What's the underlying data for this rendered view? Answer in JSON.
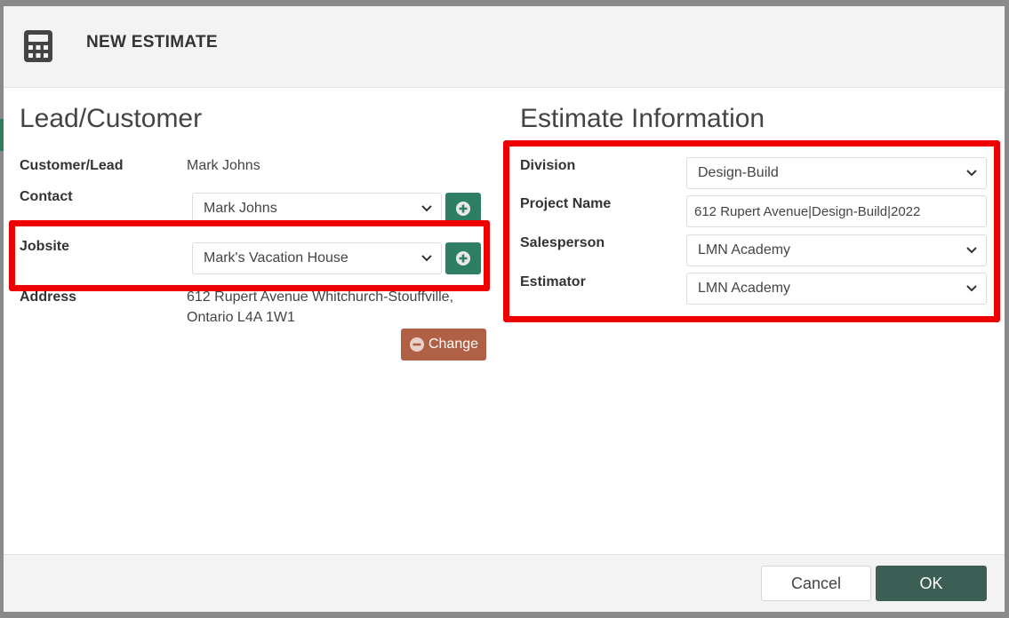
{
  "modal": {
    "title": "NEW ESTIMATE",
    "icon": "calculator-icon"
  },
  "lead_customer": {
    "section_title": "Lead/Customer",
    "customer_label": "Customer/Lead",
    "customer_value": "Mark Johns",
    "contact_label": "Contact",
    "contact_value": "Mark Johns",
    "jobsite_label": "Jobsite",
    "jobsite_value": "Mark's Vacation House",
    "address_label": "Address",
    "address_line1": "612 Rupert Avenue Whitchurch-Stouffville,",
    "address_line2": "Ontario L4A 1W1",
    "change_label": "Change"
  },
  "estimate_info": {
    "section_title": "Estimate Information",
    "division_label": "Division",
    "division_value": "Design-Build",
    "project_name_label": "Project Name",
    "project_name_value": "612 Rupert Avenue|Design-Build|2022",
    "salesperson_label": "Salesperson",
    "salesperson_value": "LMN Academy",
    "estimator_label": "Estimator",
    "estimator_value": "LMN Academy"
  },
  "footer": {
    "cancel_label": "Cancel",
    "ok_label": "OK"
  },
  "colors": {
    "add_button": "#2e7d65",
    "change_button": "#b06045",
    "ok_button": "#3c5f55",
    "highlight": "#ee0000"
  }
}
